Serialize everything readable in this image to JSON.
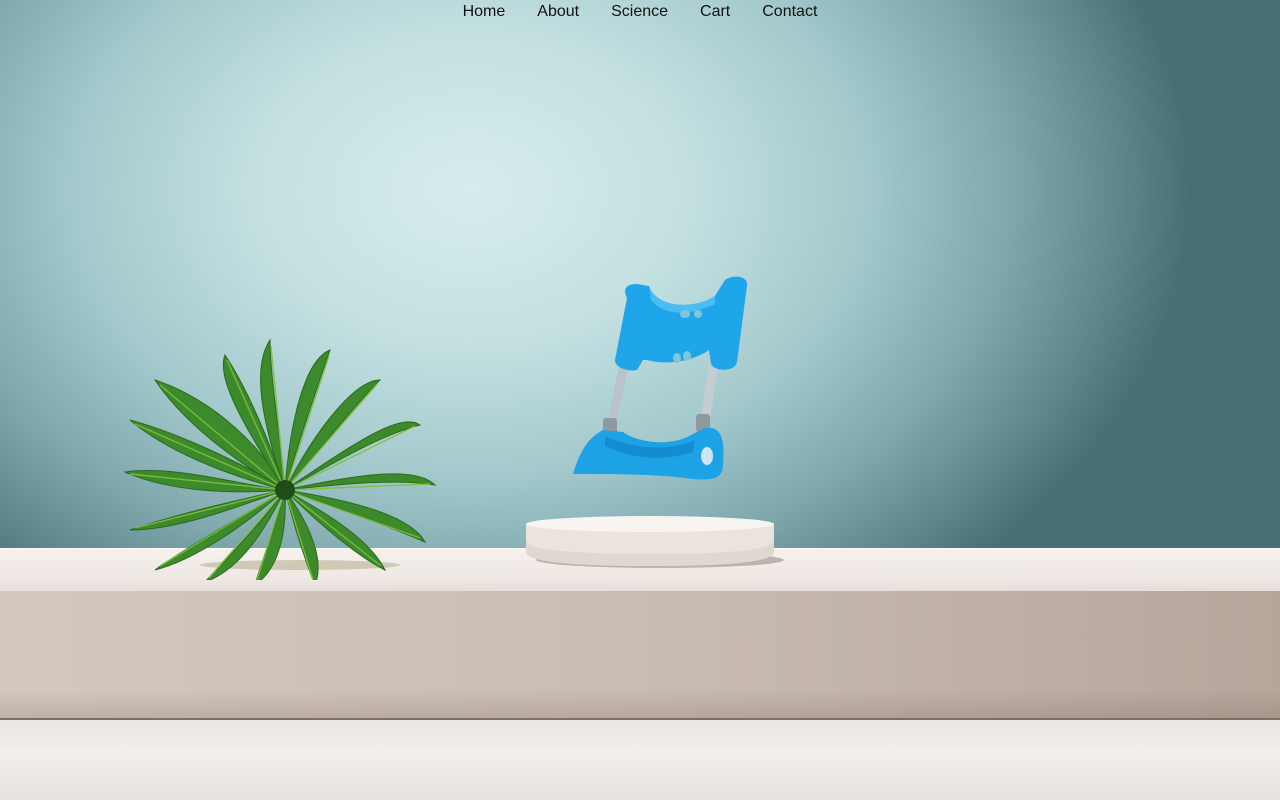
{
  "nav": {
    "items": [
      {
        "label": "Home"
      },
      {
        "label": "About"
      },
      {
        "label": "Science"
      },
      {
        "label": "Cart"
      },
      {
        "label": "Contact"
      }
    ]
  },
  "hero": {
    "product_color": "#1fa6ea",
    "plant_color": "#3f8a2c",
    "background_accent": "#c9e3e4",
    "shelf_color": "#efe8e4"
  },
  "icons": {
    "product": "extender-device-image",
    "plant": "monstera-leaf-image",
    "pedestal": "round-pedestal-image"
  }
}
